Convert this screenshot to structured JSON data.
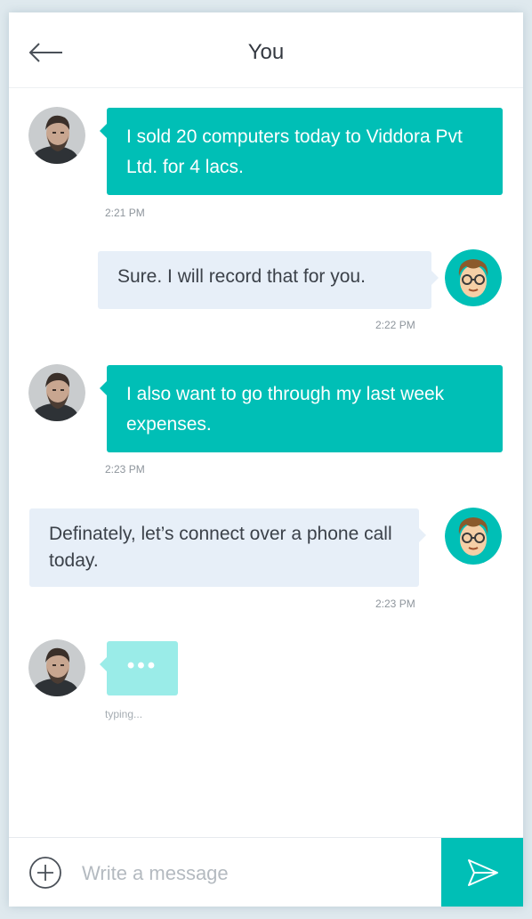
{
  "header": {
    "title": "You",
    "back_icon": "arrow-left-icon"
  },
  "messages": [
    {
      "direction": "incoming",
      "text": "I sold 20 computers today to Viddora Pvt Ltd. for 4 lacs.",
      "time": "2:21 PM",
      "avatar": "bearded-man-photo-avatar"
    },
    {
      "direction": "outgoing",
      "text": "Sure. I will record that for you.",
      "time": "2:22 PM",
      "avatar": "cartoon-man-glasses-avatar"
    },
    {
      "direction": "incoming",
      "text": "I also want to go through my last week expenses.",
      "time": "2:23 PM",
      "avatar": "bearded-man-photo-avatar"
    },
    {
      "direction": "outgoing",
      "text": "Definately, let’s connect over a phone call today.",
      "time": "2:23 PM",
      "avatar": "cartoon-man-glasses-avatar"
    }
  ],
  "typing": {
    "dots": "•••",
    "label": "typing..."
  },
  "composer": {
    "placeholder": "Write a message",
    "value": "",
    "add_icon": "plus-circle-icon",
    "send_icon": "send-icon"
  },
  "colors": {
    "accent": "#00bfb6",
    "incoming_bubble": "#00bfb6",
    "outgoing_bubble": "#e7eff8",
    "typing_bubble": "#9aece8"
  }
}
